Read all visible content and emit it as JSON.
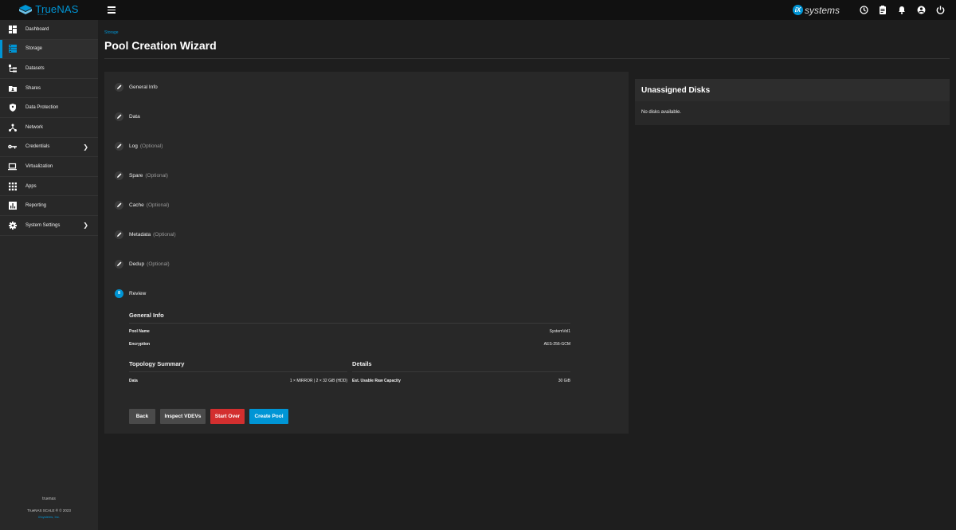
{
  "brand": {
    "name": "TrueNAS",
    "edition": "SCALE"
  },
  "header": {
    "vendor_prefix": "iX",
    "vendor_name": "systems",
    "icons": [
      "truecommand-icon",
      "jobs-icon",
      "bell-icon",
      "account-icon",
      "power-icon"
    ]
  },
  "sidebar": {
    "items": [
      {
        "label": "Dashboard",
        "icon": "dashboard-icon"
      },
      {
        "label": "Storage",
        "icon": "storage-icon"
      },
      {
        "label": "Datasets",
        "icon": "datasets-icon"
      },
      {
        "label": "Shares",
        "icon": "shares-icon"
      },
      {
        "label": "Data Protection",
        "icon": "shield-icon"
      },
      {
        "label": "Network",
        "icon": "network-icon"
      },
      {
        "label": "Credentials",
        "icon": "key-icon"
      },
      {
        "label": "Virtualization",
        "icon": "laptop-icon"
      },
      {
        "label": "Apps",
        "icon": "apps-icon"
      },
      {
        "label": "Reporting",
        "icon": "reporting-icon"
      },
      {
        "label": "System Settings",
        "icon": "gear-icon"
      }
    ],
    "footer": {
      "hostname": "truenas",
      "copyright": "TrueNAS SCALE ® © 2023",
      "company": "iXsystems, Inc."
    }
  },
  "page": {
    "breadcrumb": "Storage",
    "title": "Pool Creation Wizard"
  },
  "wizard": {
    "steps": [
      {
        "label": "General Info",
        "optional": ""
      },
      {
        "label": "Data",
        "optional": ""
      },
      {
        "label": "Log",
        "optional": "(Optional)"
      },
      {
        "label": "Spare",
        "optional": "(Optional)"
      },
      {
        "label": "Cache",
        "optional": "(Optional)"
      },
      {
        "label": "Metadata",
        "optional": "(Optional)"
      },
      {
        "label": "Dedup",
        "optional": "(Optional)"
      },
      {
        "label": "Review",
        "optional": "",
        "number": "8"
      }
    ],
    "review": {
      "general_info_title": "General Info",
      "pool_name_label": "Pool Name",
      "pool_name_value": "SystemVol1",
      "encryption_label": "Encryption",
      "encryption_value": "AES-256-GCM",
      "topology_title": "Topology Summary",
      "data_label": "Data",
      "data_value": "1 × MIRROR | 2 × 32 GiB (HDD)",
      "details_title": "Details",
      "capacity_label": "Est. Usable Raw Capacity",
      "capacity_value": "30 GiB"
    },
    "buttons": {
      "back": "Back",
      "inspect": "Inspect VDEVs",
      "start_over": "Start Over",
      "create": "Create Pool"
    }
  },
  "disks": {
    "title": "Unassigned Disks",
    "empty": "No disks available."
  },
  "colors": {
    "accent": "#0095d5",
    "danger": "#d32f2f",
    "neutral_button": "#4a4a4a"
  }
}
